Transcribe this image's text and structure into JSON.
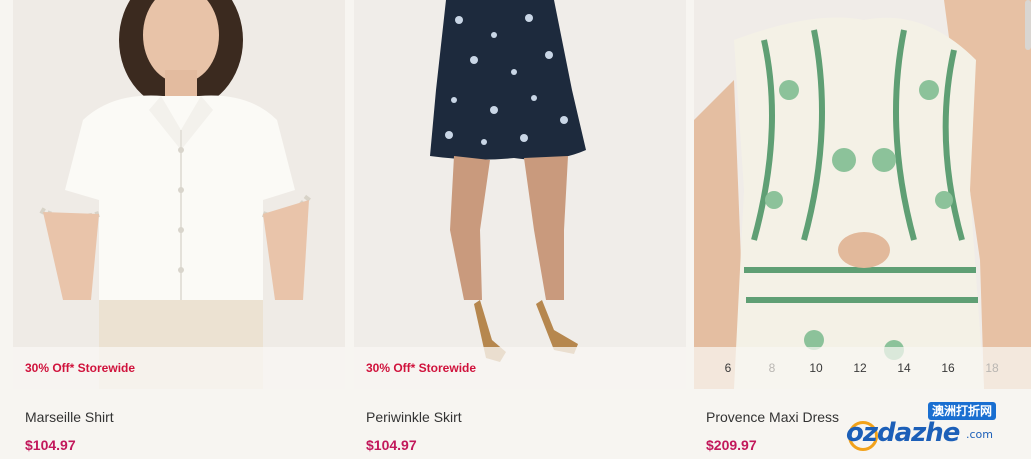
{
  "products": [
    {
      "name": "Marseille Shirt",
      "price": "$104.97",
      "promo": "30% Off* Storewide",
      "image": "woman-in-white-shirt"
    },
    {
      "name": "Periwinkle Skirt",
      "price": "$104.97",
      "promo": "30% Off* Storewide",
      "image": "floral-navy-skirt"
    },
    {
      "name": "Provence Maxi Dress",
      "price": "$209.97",
      "image": "green-print-maxi-dress",
      "sizes": [
        {
          "label": "6",
          "available": true
        },
        {
          "label": "8",
          "available": false
        },
        {
          "label": "10",
          "available": true
        },
        {
          "label": "12",
          "available": true
        },
        {
          "label": "14",
          "available": true
        },
        {
          "label": "16",
          "available": true
        },
        {
          "label": "18",
          "available": false
        }
      ]
    }
  ],
  "watermark": {
    "badge": "澳洲打折网",
    "text": "ozdazhe",
    "suffix": ".com"
  },
  "colors": {
    "promo": "#d0123c",
    "price": "#c2185b",
    "background": "#f7f5f1"
  }
}
